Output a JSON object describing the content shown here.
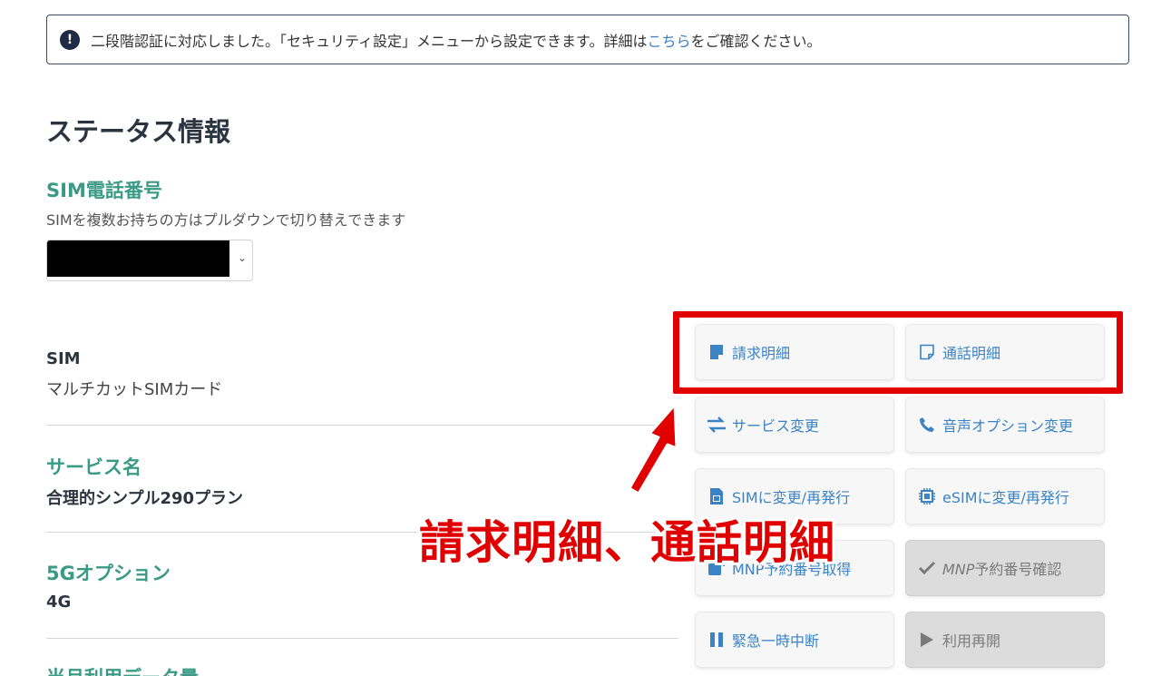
{
  "notice": {
    "text_before": "二段階認証に対応しました。「セキュリティ設定」メニューから設定できます。詳細は",
    "link": "こちら",
    "text_after": "をご確認ください。"
  },
  "page_title": "ステータス情報",
  "sim_section": {
    "title": "SIM電話番号",
    "description": "SIMを複数お持ちの方はプルダウンで切り替えできます"
  },
  "info": {
    "sim_label": "SIM",
    "sim_value": "マルチカットSIMカード",
    "service_label": "サービス名",
    "service_value": "合理的シンプル290プラン",
    "fiveg_label": "5Gオプション",
    "fiveg_value": "4G",
    "data_label": "当月利用データ量"
  },
  "buttons": {
    "billing": "請求明細",
    "call_details": "通話明細",
    "service_change": "サービス変更",
    "voice_option": "音声オプション変更",
    "sim_reissue": "SIMに変更/再発行",
    "esim_reissue": "eSIMに変更/再発行",
    "mnp_get_mnp": "MNP",
    "mnp_get_rest": "予約番号取得",
    "mnp_confirm_mnp": "MNP",
    "mnp_confirm_rest": "予約番号確認",
    "emergency_stop": "緊急一時中断",
    "resume": "利用再開"
  },
  "annotation": "請求明細、通話明細",
  "colors": {
    "accent": "#3a9a86",
    "link": "#3b83c4",
    "highlight": "#e00000"
  }
}
